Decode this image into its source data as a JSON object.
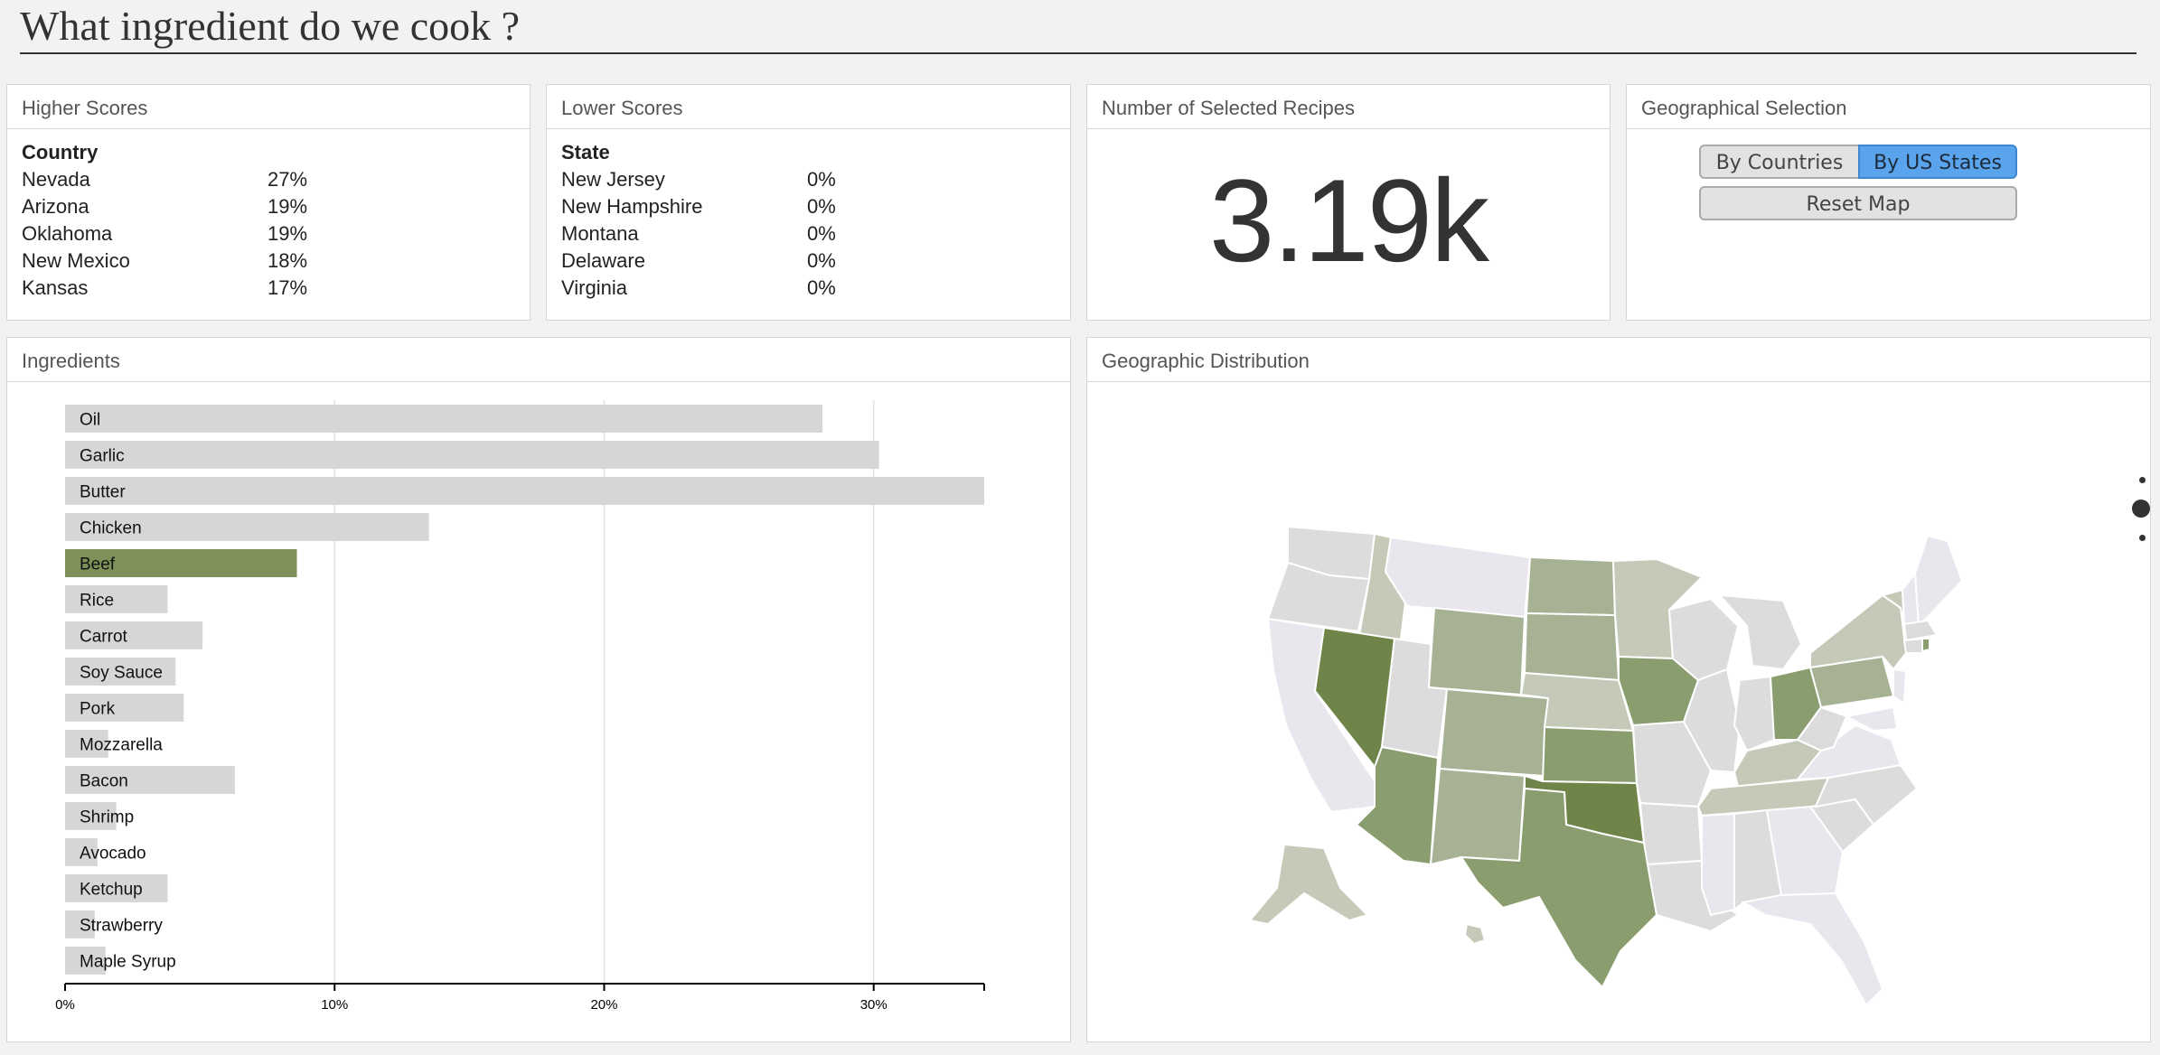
{
  "page": {
    "title": "What ingredient do we cook ?"
  },
  "higher_scores": {
    "header": "Higher Scores",
    "column": "Country",
    "rows": [
      {
        "name": "Nevada",
        "value": "27%"
      },
      {
        "name": "Arizona",
        "value": "19%"
      },
      {
        "name": "Oklahoma",
        "value": "19%"
      },
      {
        "name": "New Mexico",
        "value": "18%"
      },
      {
        "name": "Kansas",
        "value": "17%"
      }
    ]
  },
  "lower_scores": {
    "header": "Lower Scores",
    "column": "State",
    "rows": [
      {
        "name": "New Jersey",
        "value": "0%"
      },
      {
        "name": "New Hampshire",
        "value": "0%"
      },
      {
        "name": "Montana",
        "value": "0%"
      },
      {
        "name": "Delaware",
        "value": "0%"
      },
      {
        "name": "Virginia",
        "value": "0%"
      }
    ]
  },
  "selected_recipes": {
    "header": "Number of Selected Recipes",
    "value": "3.19k"
  },
  "geo_selection": {
    "header": "Geographical Selection",
    "btn_countries": "By Countries",
    "btn_states": "By US States",
    "btn_reset": "Reset Map",
    "active": "By US States"
  },
  "ingredients": {
    "header": "Ingredients"
  },
  "geo_distribution": {
    "header": "Geographic Distribution"
  },
  "colors": {
    "bar": "#d6d6d6",
    "bar_selected": "#7d9158",
    "map_darkest": "#6e8448",
    "map_dark": "#8a9d6e",
    "map_mid": "#a6b293",
    "map_light": "#c5cab8",
    "map_lighter": "#dcdcdc",
    "map_lightest": "#e9e6ee"
  },
  "chart_data": {
    "type": "bar",
    "orientation": "horizontal",
    "categories": [
      "Oil",
      "Garlic",
      "Butter",
      "Chicken",
      "Beef",
      "Rice",
      "Carrot",
      "Soy Sauce",
      "Pork",
      "Mozzarella",
      "Bacon",
      "Shrimp",
      "Avocado",
      "Ketchup",
      "Strawberry",
      "Maple Syrup"
    ],
    "values": [
      28.1,
      30.2,
      34.1,
      13.5,
      8.6,
      3.8,
      5.1,
      4.1,
      4.4,
      1.6,
      6.3,
      1.9,
      1.2,
      3.8,
      1.1,
      1.5
    ],
    "selected": "Beef",
    "xlim": [
      0,
      34.1
    ],
    "xticks": [
      "0%",
      "10%",
      "20%",
      "30%"
    ],
    "xtick_values": [
      0,
      10,
      20,
      30
    ],
    "grid": true
  }
}
